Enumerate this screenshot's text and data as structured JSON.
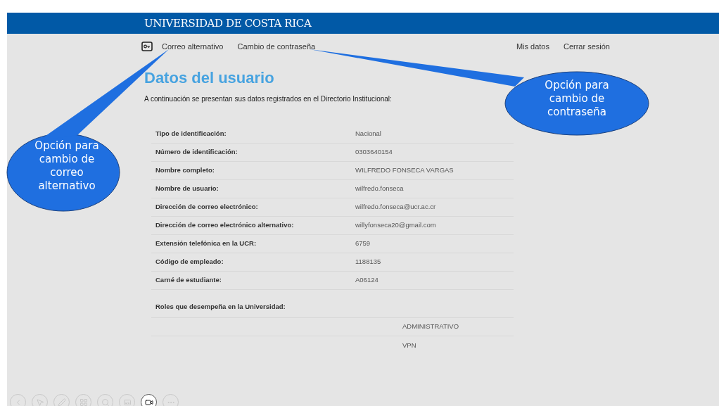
{
  "header": {
    "title": "UNIVERSIDAD DE COSTA RICA"
  },
  "nav": {
    "left": [
      "Correo alternativo",
      "Cambio de contraseña"
    ],
    "right": [
      "Mis datos",
      "Cerrar sesión"
    ]
  },
  "page": {
    "heading": "Datos del usuario",
    "intro": "A continuación se presentan sus datos registrados en el Directorio Institucional:"
  },
  "fields": [
    {
      "label": "Tipo de identificación:",
      "value": "Nacional"
    },
    {
      "label": "Número de identificación:",
      "value": "0303640154"
    },
    {
      "label": "Nombre completo:",
      "value": "WILFREDO FONSECA VARGAS"
    },
    {
      "label": "Nombre de usuario:",
      "value": "wilfredo.fonseca"
    },
    {
      "label": "Dirección de correo electrónico:",
      "value": "wilfredo.fonseca@ucr.ac.cr"
    },
    {
      "label": "Dirección de correo electrónico alternativo:",
      "value": "willyfonseca20@gmail.com"
    },
    {
      "label": "Extensión telefónica en la UCR:",
      "value": "6759"
    },
    {
      "label": "Código de empleado:",
      "value": "1188135"
    },
    {
      "label": "Carné de estudiante:",
      "value": "A06124"
    }
  ],
  "roles": {
    "label": "Roles que desempeña en la Universidad:",
    "items": [
      "ADMINISTRATIVO",
      "VPN"
    ]
  },
  "callouts": [
    {
      "kind": "left",
      "text": "Opción para cambio de correo alternativo"
    },
    {
      "kind": "right",
      "text": "Opción para cambio de contraseña"
    }
  ],
  "toolbar": [
    {
      "kind": "back",
      "selected": false
    },
    {
      "kind": "pointer",
      "selected": false
    },
    {
      "kind": "pen",
      "selected": false
    },
    {
      "kind": "grid",
      "selected": false
    },
    {
      "kind": "zoom",
      "selected": false
    },
    {
      "kind": "subtitles",
      "selected": false
    },
    {
      "kind": "camera",
      "selected": true
    },
    {
      "kind": "more",
      "selected": false
    }
  ]
}
